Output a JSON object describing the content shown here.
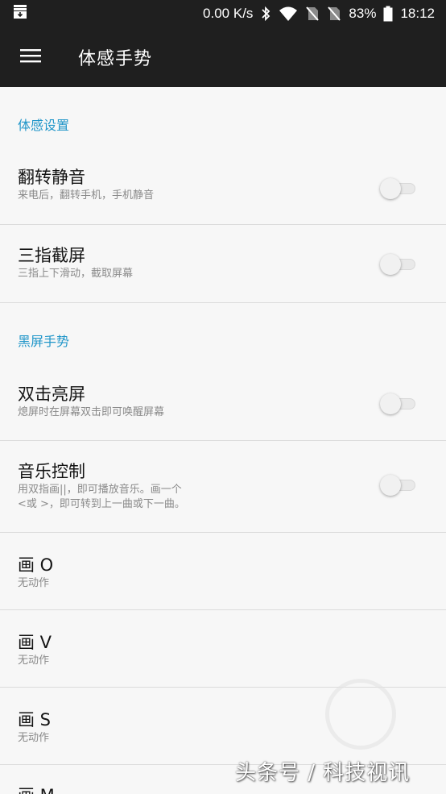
{
  "status_bar": {
    "network_speed": "0.00 K/s",
    "battery": "83%",
    "time": "18:12"
  },
  "toolbar": {
    "title": "体感手势"
  },
  "sections": {
    "motion": {
      "header": "体感设置",
      "flip_mute": {
        "title": "翻转静音",
        "subtitle": "来电后，翻转手机，手机静音",
        "enabled": false
      },
      "three_finger": {
        "title": "三指截屏",
        "subtitle": "三指上下滑动，截取屏幕",
        "enabled": false
      }
    },
    "screen_off": {
      "header": "黑屏手势",
      "double_tap": {
        "title": "双击亮屏",
        "subtitle": "熄屏时在屏幕双击即可唤醒屏幕",
        "enabled": false
      },
      "music": {
        "title": "音乐控制",
        "subtitle_line1": "用双指画||，即可播放音乐。画一个",
        "subtitle_line2": "<或 >，即可转到上一曲或下一曲。",
        "enabled": false
      },
      "draw_o": {
        "title": "画 O",
        "subtitle": "无动作"
      },
      "draw_v": {
        "title": "画 V",
        "subtitle": "无动作"
      },
      "draw_s": {
        "title": "画 S",
        "subtitle": "无动作"
      },
      "draw_m": {
        "title": "画 M"
      }
    }
  },
  "watermark": {
    "text": "头条号 / 科技视讯"
  }
}
